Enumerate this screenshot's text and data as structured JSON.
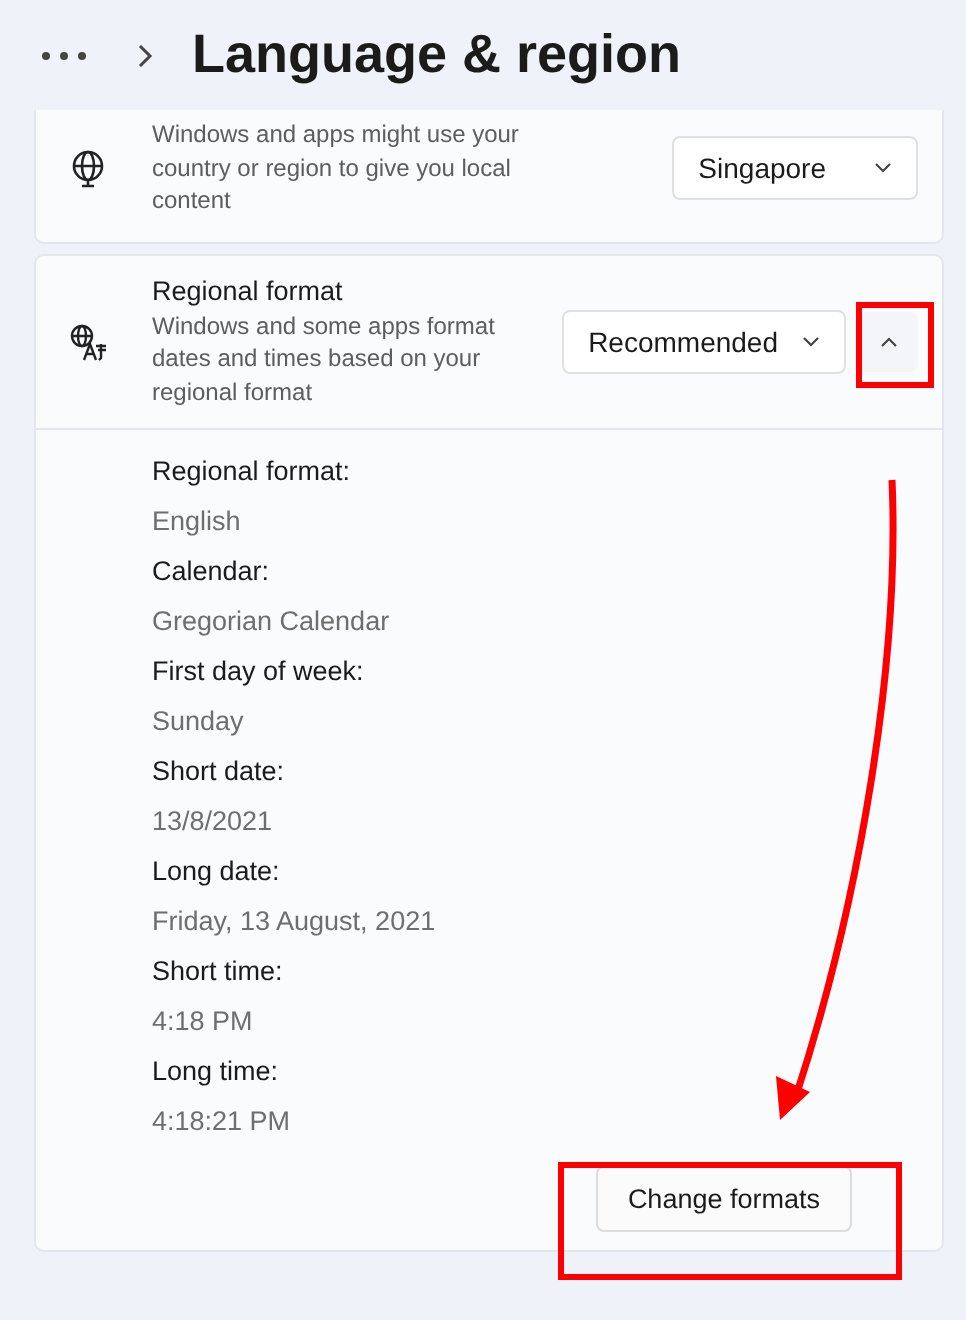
{
  "header": {
    "title": "Language & region"
  },
  "settings": [
    {
      "kind": "dropdown",
      "description": "Windows and apps might use your country or region to give you local content",
      "value": "Singapore"
    },
    {
      "kind": "expander",
      "title": "Regional format",
      "description": "Windows and some apps format dates and times based on your regional format",
      "value": "Recommended",
      "expanded": true
    }
  ],
  "details": [
    {
      "label": "Regional format:",
      "value": "English"
    },
    {
      "label": "Calendar:",
      "value": "Gregorian Calendar"
    },
    {
      "label": "First day of week:",
      "value": "Sunday"
    },
    {
      "label": "Short date:",
      "value": "13/8/2021"
    },
    {
      "label": "Long date:",
      "value": "Friday, 13 August, 2021"
    },
    {
      "label": "Short time:",
      "value": "4:18 PM"
    },
    {
      "label": "Long time:",
      "value": "4:18:21 PM"
    }
  ],
  "action_button": "Change formats"
}
